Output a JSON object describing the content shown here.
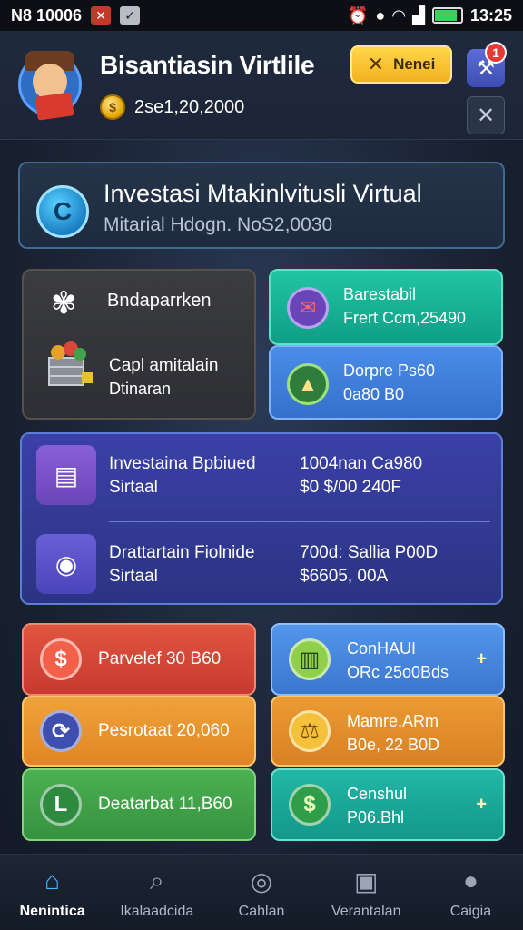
{
  "status_bar": {
    "left_text": "N8 10006",
    "time": "13:25"
  },
  "header": {
    "app_title": "Bisantiasin Virtlile",
    "balance": "2se1,20,2000",
    "yellow_button_label": "Nenei",
    "notification_count": "1"
  },
  "hero_card": {
    "title": "Investasi Mtakinlvitusli Virtual",
    "subtitle": "Mitarial Hdogn. NoS2,0030"
  },
  "grey_panel": {
    "title": "Bndaparrken",
    "line1": "Capl amitalain",
    "line2": "Dtinaran"
  },
  "teal_card": {
    "line1": "Barestabil",
    "line2": "Frert Ccm,25490"
  },
  "blue_card": {
    "line1": "Dorpre Ps60",
    "line2": "0a80 B0"
  },
  "invest_panel": {
    "rows": [
      {
        "left1": "Investaina Bpbiued",
        "left2": "Sirtaal",
        "right1": "1004nan Ca980",
        "right2": "$0 $/00 240F"
      },
      {
        "left1": "Drattartain Fiolnide",
        "left2": "Sirtaal",
        "right1": "700d: Sallia P00D",
        "right2": "$6605, 00A"
      }
    ]
  },
  "metrics_left": [
    {
      "label": "Parvelef 30 B60",
      "icon": "dollar-icon",
      "color": "#d9473a"
    },
    {
      "label": "Pesrotaat 20,060",
      "icon": "sync-icon",
      "color": "#e8962a"
    },
    {
      "label": "Deatarbat 11,B60",
      "icon": "ledger-icon",
      "color": "#3fa44c"
    }
  ],
  "metrics_right": [
    {
      "line1": "ConHAUI",
      "line2": "ORc 25o0Bds",
      "icon": "chart-icon",
      "color": "#4a8de8"
    },
    {
      "line1": "Mamre,ARm",
      "line2": "B0e, 22 B0D",
      "icon": "scale-icon",
      "color": "#e0902b"
    },
    {
      "line1": "Censhul",
      "line2": "P06.Bhl",
      "icon": "dollar-icon",
      "color": "#1aa998"
    }
  ],
  "bottom_nav": [
    {
      "label": "Nenintica",
      "icon": "home-icon",
      "active": true
    },
    {
      "label": "Ikalaadcida",
      "icon": "search-icon",
      "active": false
    },
    {
      "label": "Cahlan",
      "icon": "globe-icon",
      "active": false
    },
    {
      "label": "Verantalan",
      "icon": "message-icon",
      "active": false
    },
    {
      "label": "Caigia",
      "icon": "profile-icon",
      "active": false
    }
  ]
}
